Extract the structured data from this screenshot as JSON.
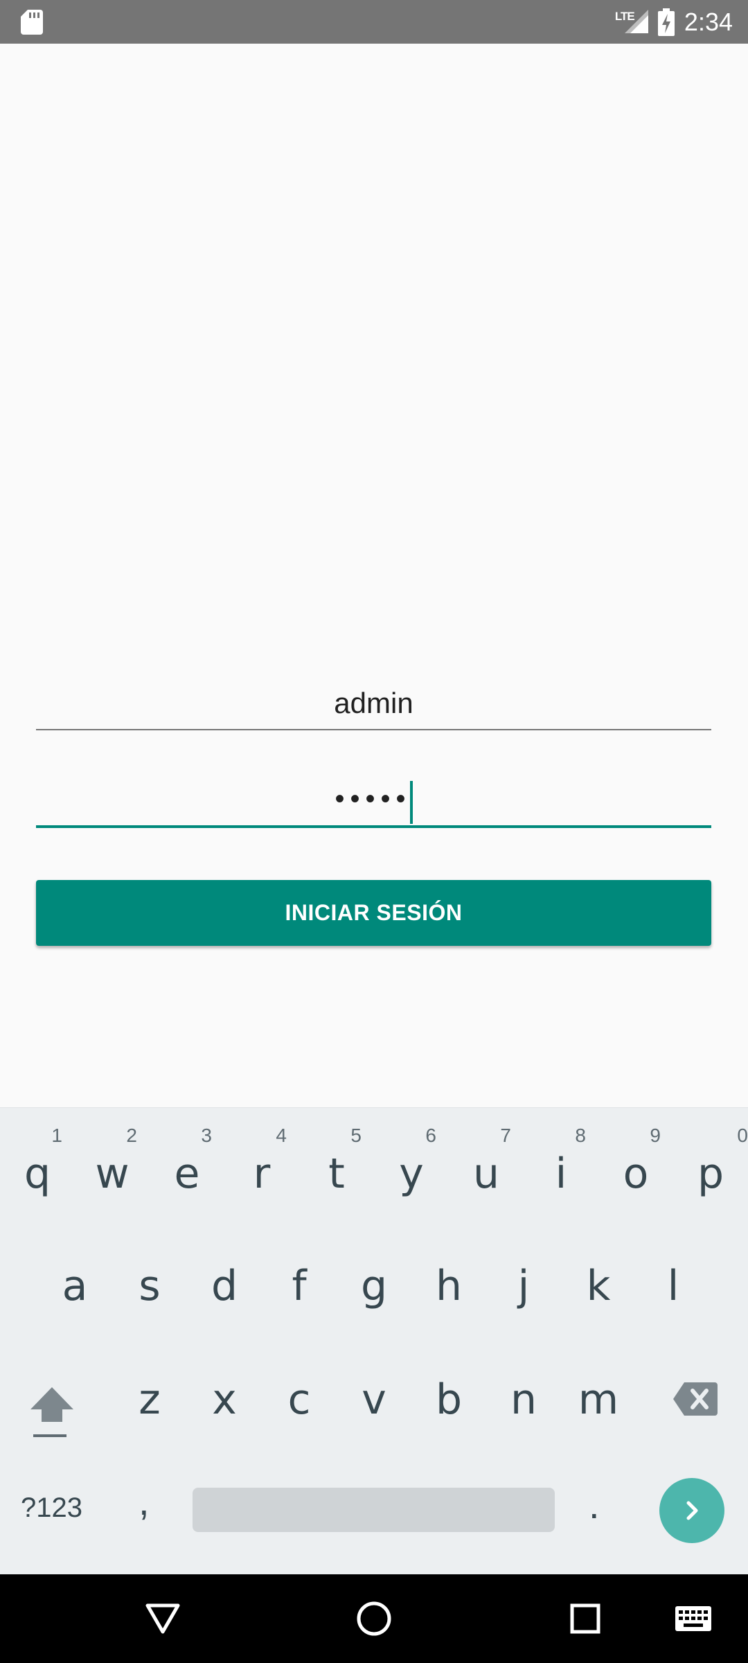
{
  "status_bar": {
    "network": "LTE",
    "time": "2:34"
  },
  "login": {
    "username": "admin",
    "password_masked": "•••••",
    "login_button": "INICIAR SESIÓN"
  },
  "keyboard": {
    "row1": [
      {
        "key": "q",
        "hint": "1"
      },
      {
        "key": "w",
        "hint": "2"
      },
      {
        "key": "e",
        "hint": "3"
      },
      {
        "key": "r",
        "hint": "4"
      },
      {
        "key": "t",
        "hint": "5"
      },
      {
        "key": "y",
        "hint": "6"
      },
      {
        "key": "u",
        "hint": "7"
      },
      {
        "key": "i",
        "hint": "8"
      },
      {
        "key": "o",
        "hint": "9"
      },
      {
        "key": "p",
        "hint": "0"
      }
    ],
    "row2": [
      "a",
      "s",
      "d",
      "f",
      "g",
      "h",
      "j",
      "k",
      "l"
    ],
    "row3": [
      "z",
      "x",
      "c",
      "v",
      "b",
      "n",
      "m"
    ],
    "symbols_key": "?123",
    "comma_key": ",",
    "period_key": "."
  },
  "colors": {
    "accent": "#00897b",
    "go_key": "#4db6ac",
    "status_bar": "#757575",
    "keyboard_bg": "#eceff1"
  },
  "icons": [
    "sd-card-icon",
    "signal-icon",
    "battery-charging-icon",
    "shift-icon",
    "backspace-icon",
    "go-arrow-icon",
    "back-icon",
    "home-icon",
    "recents-icon",
    "keyboard-icon"
  ]
}
